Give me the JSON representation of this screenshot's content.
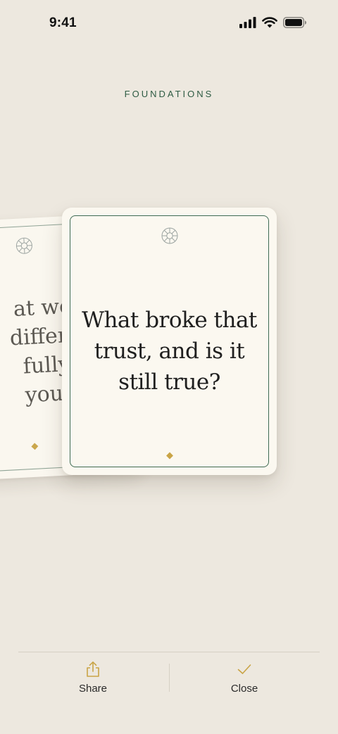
{
  "status_bar": {
    "time": "9:41",
    "icons": [
      "signal-icon",
      "wifi-icon",
      "battery-icon"
    ]
  },
  "category": {
    "label": "FOUNDATIONS"
  },
  "cards": {
    "current": {
      "question_lines": [
        "What broke that",
        "trust, and is it",
        "still true?"
      ],
      "emblem_icon": "flower-emblem-icon"
    },
    "previous": {
      "question_lines_visible": [
        "at woul",
        "differen",
        "fully tr",
        "yourse"
      ],
      "emblem_icon": "flower-emblem-icon"
    }
  },
  "toolbar": {
    "share_label": "Share",
    "share_icon": "share-icon",
    "close_label": "Close",
    "close_icon": "checkmark-icon"
  },
  "colors": {
    "background": "#ede8df",
    "card": "#fbf8f0",
    "accent_green": "#2e5b43",
    "accent_gold": "#c9a446"
  }
}
